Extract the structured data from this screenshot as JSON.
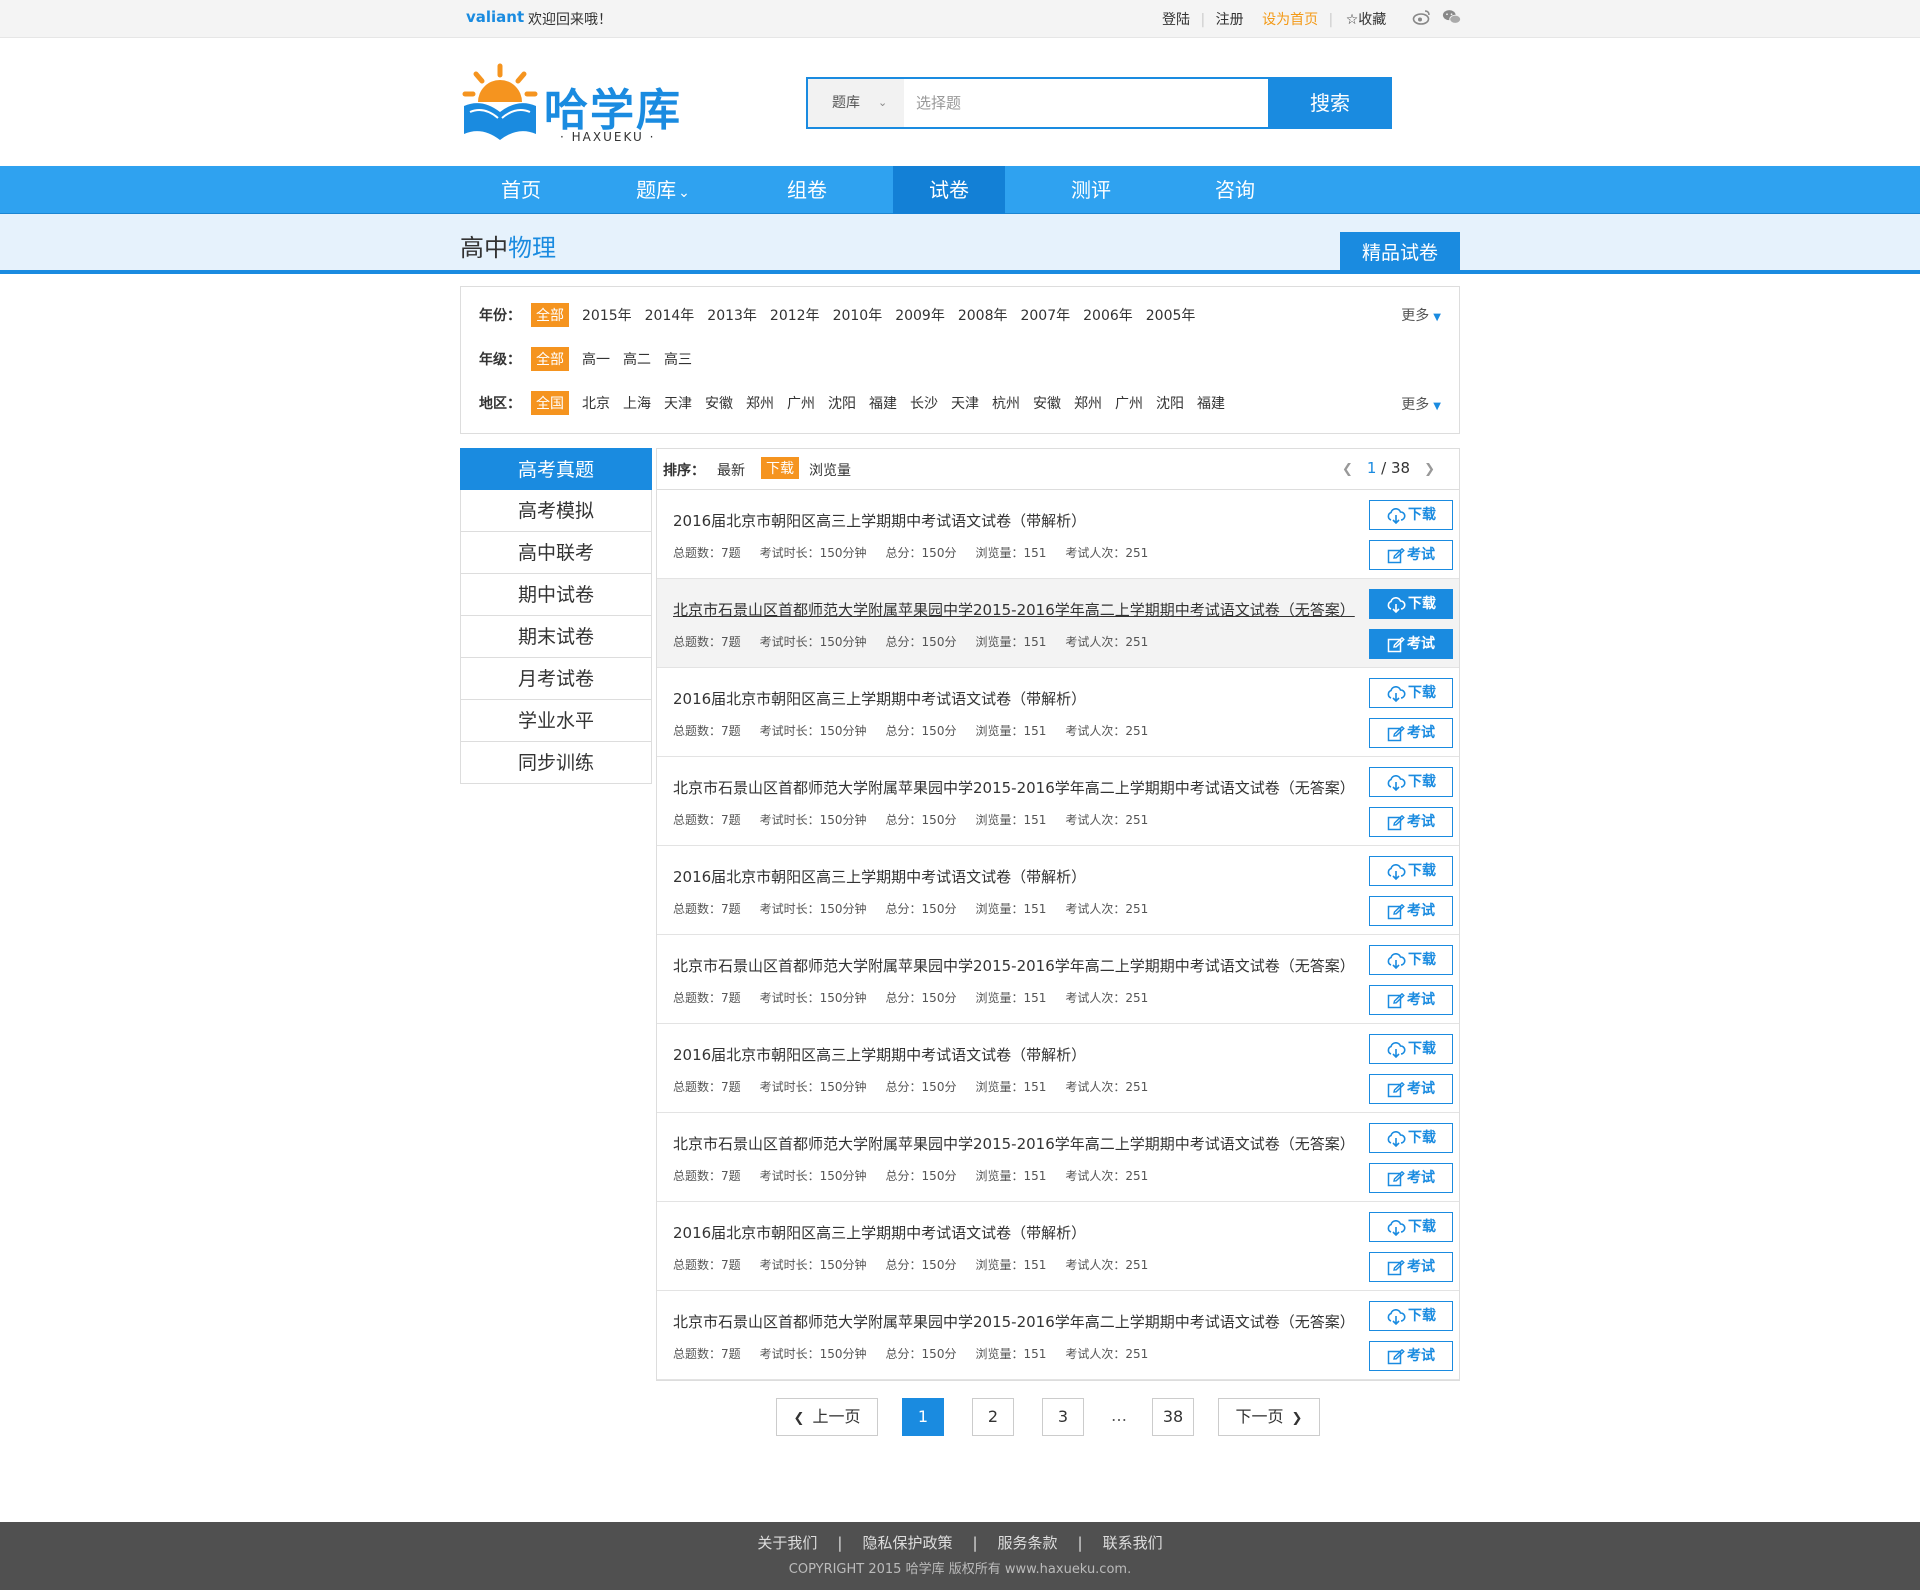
{
  "topbar": {
    "username": "valiant",
    "welcome": "欢迎回来哦！",
    "login": "登陆",
    "divider": "|",
    "register": "注册",
    "set_home": "设为首页",
    "favorite": "收藏",
    "social_icons": [
      "weibo-icon",
      "wechat-icon"
    ]
  },
  "logo": {
    "name": "哈学库",
    "sub": "· HAXUEKU ·"
  },
  "search": {
    "category": "题库",
    "placeholder": "选择题",
    "value": "",
    "button": "搜索"
  },
  "nav": {
    "items": [
      "首页",
      "题库",
      "组卷",
      "试卷",
      "测评",
      "咨询"
    ],
    "active": "试卷"
  },
  "banner": {
    "level": "高中",
    "subject": "物理",
    "tab": "精品试卷"
  },
  "filters": {
    "year": {
      "label": "年份：",
      "options": [
        "全部",
        "2015年",
        "2014年",
        "2013年",
        "2012年",
        "2010年",
        "2009年",
        "2008年",
        "2007年",
        "2006年",
        "2005年"
      ],
      "more": "更多"
    },
    "grade": {
      "label": "年级：",
      "options": [
        "全部",
        "高一",
        "高二",
        "高三"
      ]
    },
    "region": {
      "label": "地区：",
      "options": [
        "全国",
        "北京",
        "上海",
        "天津",
        "安徽",
        "郑州",
        "广州",
        "沈阳",
        "福建",
        "长沙",
        "天津",
        "杭州",
        "安徽",
        "郑州",
        "广州",
        "沈阳",
        "福建"
      ],
      "more": "更多"
    }
  },
  "sidebar": {
    "items": [
      "高考真题",
      "高考模拟",
      "高中联考",
      "期中试卷",
      "期末试卷",
      "月考试卷",
      "学业水平",
      "同步训练"
    ],
    "active": "高考真题"
  },
  "sort": {
    "label": "排序：",
    "options": [
      "最新",
      "下载",
      "浏览量"
    ],
    "selected": "下载",
    "page_current": "1",
    "page_total": "/ 38"
  },
  "papers": [
    {
      "title": "2016届北京市朝阳区高三上学期期中考试语文试卷（带解析）",
      "count": "总题数：7题",
      "duration": "考试时长：150分钟",
      "score": "总分：150分",
      "views": "浏览量：151",
      "takers": "考试人次：251"
    },
    {
      "title": "北京市石景山区首都师范大学附属苹果园中学2015-2016学年高二上学期期中考试语文试卷（无答案）",
      "count": "总题数：7题",
      "duration": "考试时长：150分钟",
      "score": "总分：150分",
      "views": "浏览量：151",
      "takers": "考试人次：251"
    },
    {
      "title": "2016届北京市朝阳区高三上学期期中考试语文试卷（带解析）",
      "count": "总题数：7题",
      "duration": "考试时长：150分钟",
      "score": "总分：150分",
      "views": "浏览量：151",
      "takers": "考试人次：251"
    },
    {
      "title": "北京市石景山区首都师范大学附属苹果园中学2015-2016学年高二上学期期中考试语文试卷（无答案）",
      "count": "总题数：7题",
      "duration": "考试时长：150分钟",
      "score": "总分：150分",
      "views": "浏览量：151",
      "takers": "考试人次：251"
    },
    {
      "title": "2016届北京市朝阳区高三上学期期中考试语文试卷（带解析）",
      "count": "总题数：7题",
      "duration": "考试时长：150分钟",
      "score": "总分：150分",
      "views": "浏览量：151",
      "takers": "考试人次：251"
    },
    {
      "title": "北京市石景山区首都师范大学附属苹果园中学2015-2016学年高二上学期期中考试语文试卷（无答案）",
      "count": "总题数：7题",
      "duration": "考试时长：150分钟",
      "score": "总分：150分",
      "views": "浏览量：151",
      "takers": "考试人次：251"
    },
    {
      "title": "2016届北京市朝阳区高三上学期期中考试语文试卷（带解析）",
      "count": "总题数：7题",
      "duration": "考试时长：150分钟",
      "score": "总分：150分",
      "views": "浏览量：151",
      "takers": "考试人次：251"
    },
    {
      "title": "北京市石景山区首都师范大学附属苹果园中学2015-2016学年高二上学期期中考试语文试卷（无答案）",
      "count": "总题数：7题",
      "duration": "考试时长：150分钟",
      "score": "总分：150分",
      "views": "浏览量：151",
      "takers": "考试人次：251"
    },
    {
      "title": "2016届北京市朝阳区高三上学期期中考试语文试卷（带解析）",
      "count": "总题数：7题",
      "duration": "考试时长：150分钟",
      "score": "总分：150分",
      "views": "浏览量：151",
      "takers": "考试人次：251"
    },
    {
      "title": "北京市石景山区首都师范大学附属苹果园中学2015-2016学年高二上学期期中考试语文试卷（无答案）",
      "count": "总题数：7题",
      "duration": "考试时长：150分钟",
      "score": "总分：150分",
      "views": "浏览量：151",
      "takers": "考试人次：251"
    }
  ],
  "buttons": {
    "download": "下载",
    "exam": "考试"
  },
  "pagination": {
    "prev": "上一页",
    "pages": [
      "1",
      "2",
      "3"
    ],
    "ellipsis": "…",
    "last": "38",
    "next": "下一页",
    "current": "1"
  },
  "footer": {
    "links": [
      "关于我们",
      "隐私保护政策",
      "服务条款",
      "联系我们"
    ],
    "sep": "|",
    "copyright": "COPYRIGHT 2015  哈学库  版权所有   www.haxueku.com."
  },
  "colors": {
    "primary": "#1a8be0",
    "nav": "#2fa2f0",
    "accent": "#f5941f",
    "footer": "#505050"
  }
}
